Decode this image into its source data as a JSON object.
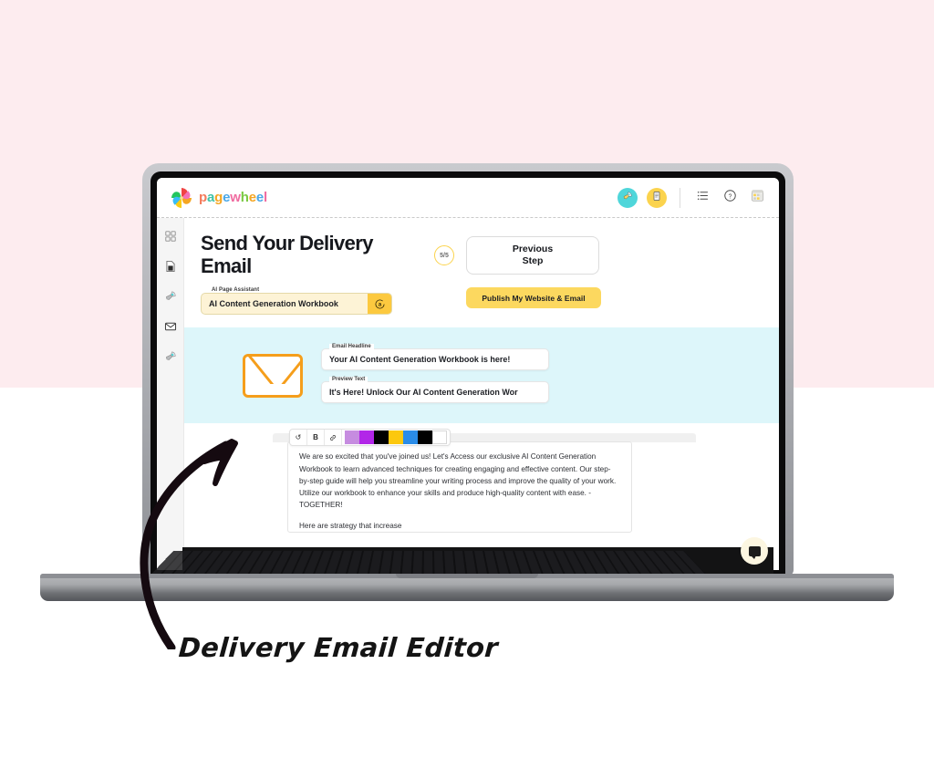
{
  "brand": {
    "name_letters": [
      {
        "char": "p",
        "color": "#f37b5b"
      },
      {
        "char": "a",
        "color": "#3fc3a8"
      },
      {
        "char": "g",
        "color": "#f5a623"
      },
      {
        "char": "e",
        "color": "#4aa8e8"
      },
      {
        "char": "w",
        "color": "#f06ba0"
      },
      {
        "char": "h",
        "color": "#7ac943"
      },
      {
        "char": "e",
        "color": "#f5a623"
      },
      {
        "char": "e",
        "color": "#4aa8e8"
      },
      {
        "char": "l",
        "color": "#f06ba0"
      }
    ],
    "logo_icon": "pinwheel-icon"
  },
  "topbar": {
    "actions": [
      {
        "name": "rocket-button",
        "icon": "rocket-icon",
        "bg": "#4fd6da"
      },
      {
        "name": "document-button",
        "icon": "document-icon",
        "bg": "#fbd34d"
      }
    ],
    "utilities": [
      {
        "name": "list-button",
        "icon": "list-icon"
      },
      {
        "name": "help-button",
        "icon": "question-circle-icon",
        "glyph": "?"
      },
      {
        "name": "apps-button",
        "icon": "grid-apps-icon"
      }
    ]
  },
  "sidebar": {
    "items": [
      {
        "name": "sidebar-item-dashboard",
        "icon": "grid-icon"
      },
      {
        "name": "sidebar-item-pages",
        "icon": "document-icon"
      },
      {
        "name": "sidebar-item-launch",
        "icon": "rocket-icon"
      },
      {
        "name": "sidebar-item-email",
        "icon": "envelope-icon"
      },
      {
        "name": "sidebar-item-publish",
        "icon": "rocket-icon"
      }
    ]
  },
  "header": {
    "title": "Send Your Delivery Email",
    "step_badge": "5/5",
    "previous_step_label": "Previous\nStep",
    "previous_step_line1": "Previous",
    "previous_step_line2": "Step",
    "publish_label": "Publish My Website & Email"
  },
  "assistant": {
    "legend": "AI Page Assistant",
    "value": "AI Content Generation Workbook",
    "button_glyph": "ⓐ",
    "button_name": "ai-assistant-button",
    "field_bg": "#fdf3d6",
    "button_bg": "#fcc93f"
  },
  "email_section": {
    "band_color": "#ddf6fa",
    "envelope_icon": "envelope-icon",
    "envelope_color": "#f59e1b",
    "fields": [
      {
        "legend": "Email Headline",
        "value": "Your AI Content Generation Workbook is here!",
        "name": "email-headline-input"
      },
      {
        "legend": "Preview Text",
        "value": "It's Here! Unlock Our AI Content Generation Wor",
        "name": "preview-text-input"
      }
    ]
  },
  "editor": {
    "toolbar_buttons": [
      {
        "name": "undo-button",
        "glyph": "↺"
      },
      {
        "name": "bold-button",
        "glyph": "B"
      },
      {
        "name": "link-button",
        "glyph": "🔗"
      }
    ],
    "swatches": [
      {
        "name": "swatch-light-purple",
        "color": "#c68ce0"
      },
      {
        "name": "swatch-purple",
        "color": "#b226e8"
      },
      {
        "name": "swatch-black",
        "color": "#000000"
      },
      {
        "name": "swatch-yellow",
        "color": "#fcc80e"
      },
      {
        "name": "swatch-blue",
        "color": "#2a8ce8"
      },
      {
        "name": "swatch-black-2",
        "color": "#000000"
      },
      {
        "name": "swatch-white",
        "color": "#ffffff"
      }
    ],
    "body_paragraph": "We are so excited that you've joined us! Let's Access our exclusive AI Content Generation Workbook to learn advanced techniques for creating engaging and effective content. Our step-by-step guide will help you streamline your writing process and improve the quality of your work. Utilize our workbook to enhance your skills and produce high-quality content with ease. - TOGETHER!",
    "body_paragraph_2": "Here are strategy that increase"
  },
  "chat": {
    "name": "chat-widget-button",
    "icon": "chat-bubble-icon",
    "bg": "#fcf6e1"
  },
  "annotation": {
    "caption": "Delivery Email Editor",
    "arrow_color": "#150a10"
  },
  "colors": {
    "page_background_top": "#fdecef",
    "page_background_bottom": "#ffffff",
    "accent_yellow": "#fcd85f",
    "accent_teal": "#4fd6da",
    "band_cyan": "#ddf6fa"
  }
}
